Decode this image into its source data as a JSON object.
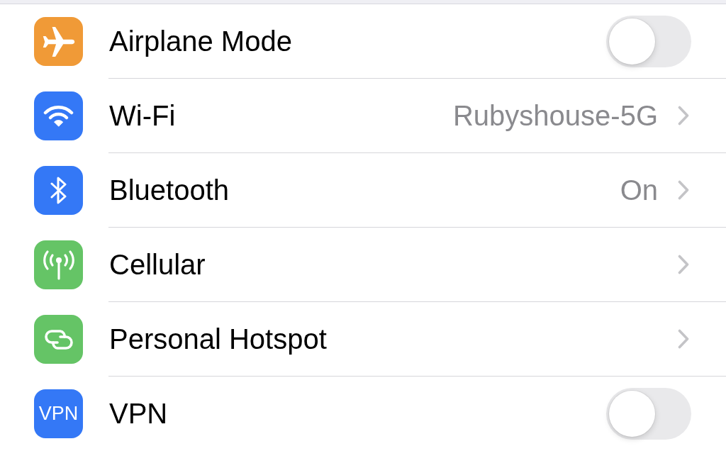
{
  "settings_list": {
    "rows": [
      {
        "kind": "toggle",
        "label": "Airplane Mode",
        "color": "#f09a37",
        "on": false
      },
      {
        "kind": "link",
        "label": "Wi-Fi",
        "value": "Rubyshouse-5G",
        "color": "#3478f6"
      },
      {
        "kind": "link",
        "label": "Bluetooth",
        "value": "On",
        "color": "#3478f6"
      },
      {
        "kind": "link",
        "label": "Cellular",
        "color": "#65c466"
      },
      {
        "kind": "link",
        "label": "Personal Hotspot",
        "color": "#65c466"
      },
      {
        "kind": "toggle",
        "label": "VPN",
        "icon_text": "VPN",
        "color": "#3478f6",
        "on": false
      }
    ]
  }
}
